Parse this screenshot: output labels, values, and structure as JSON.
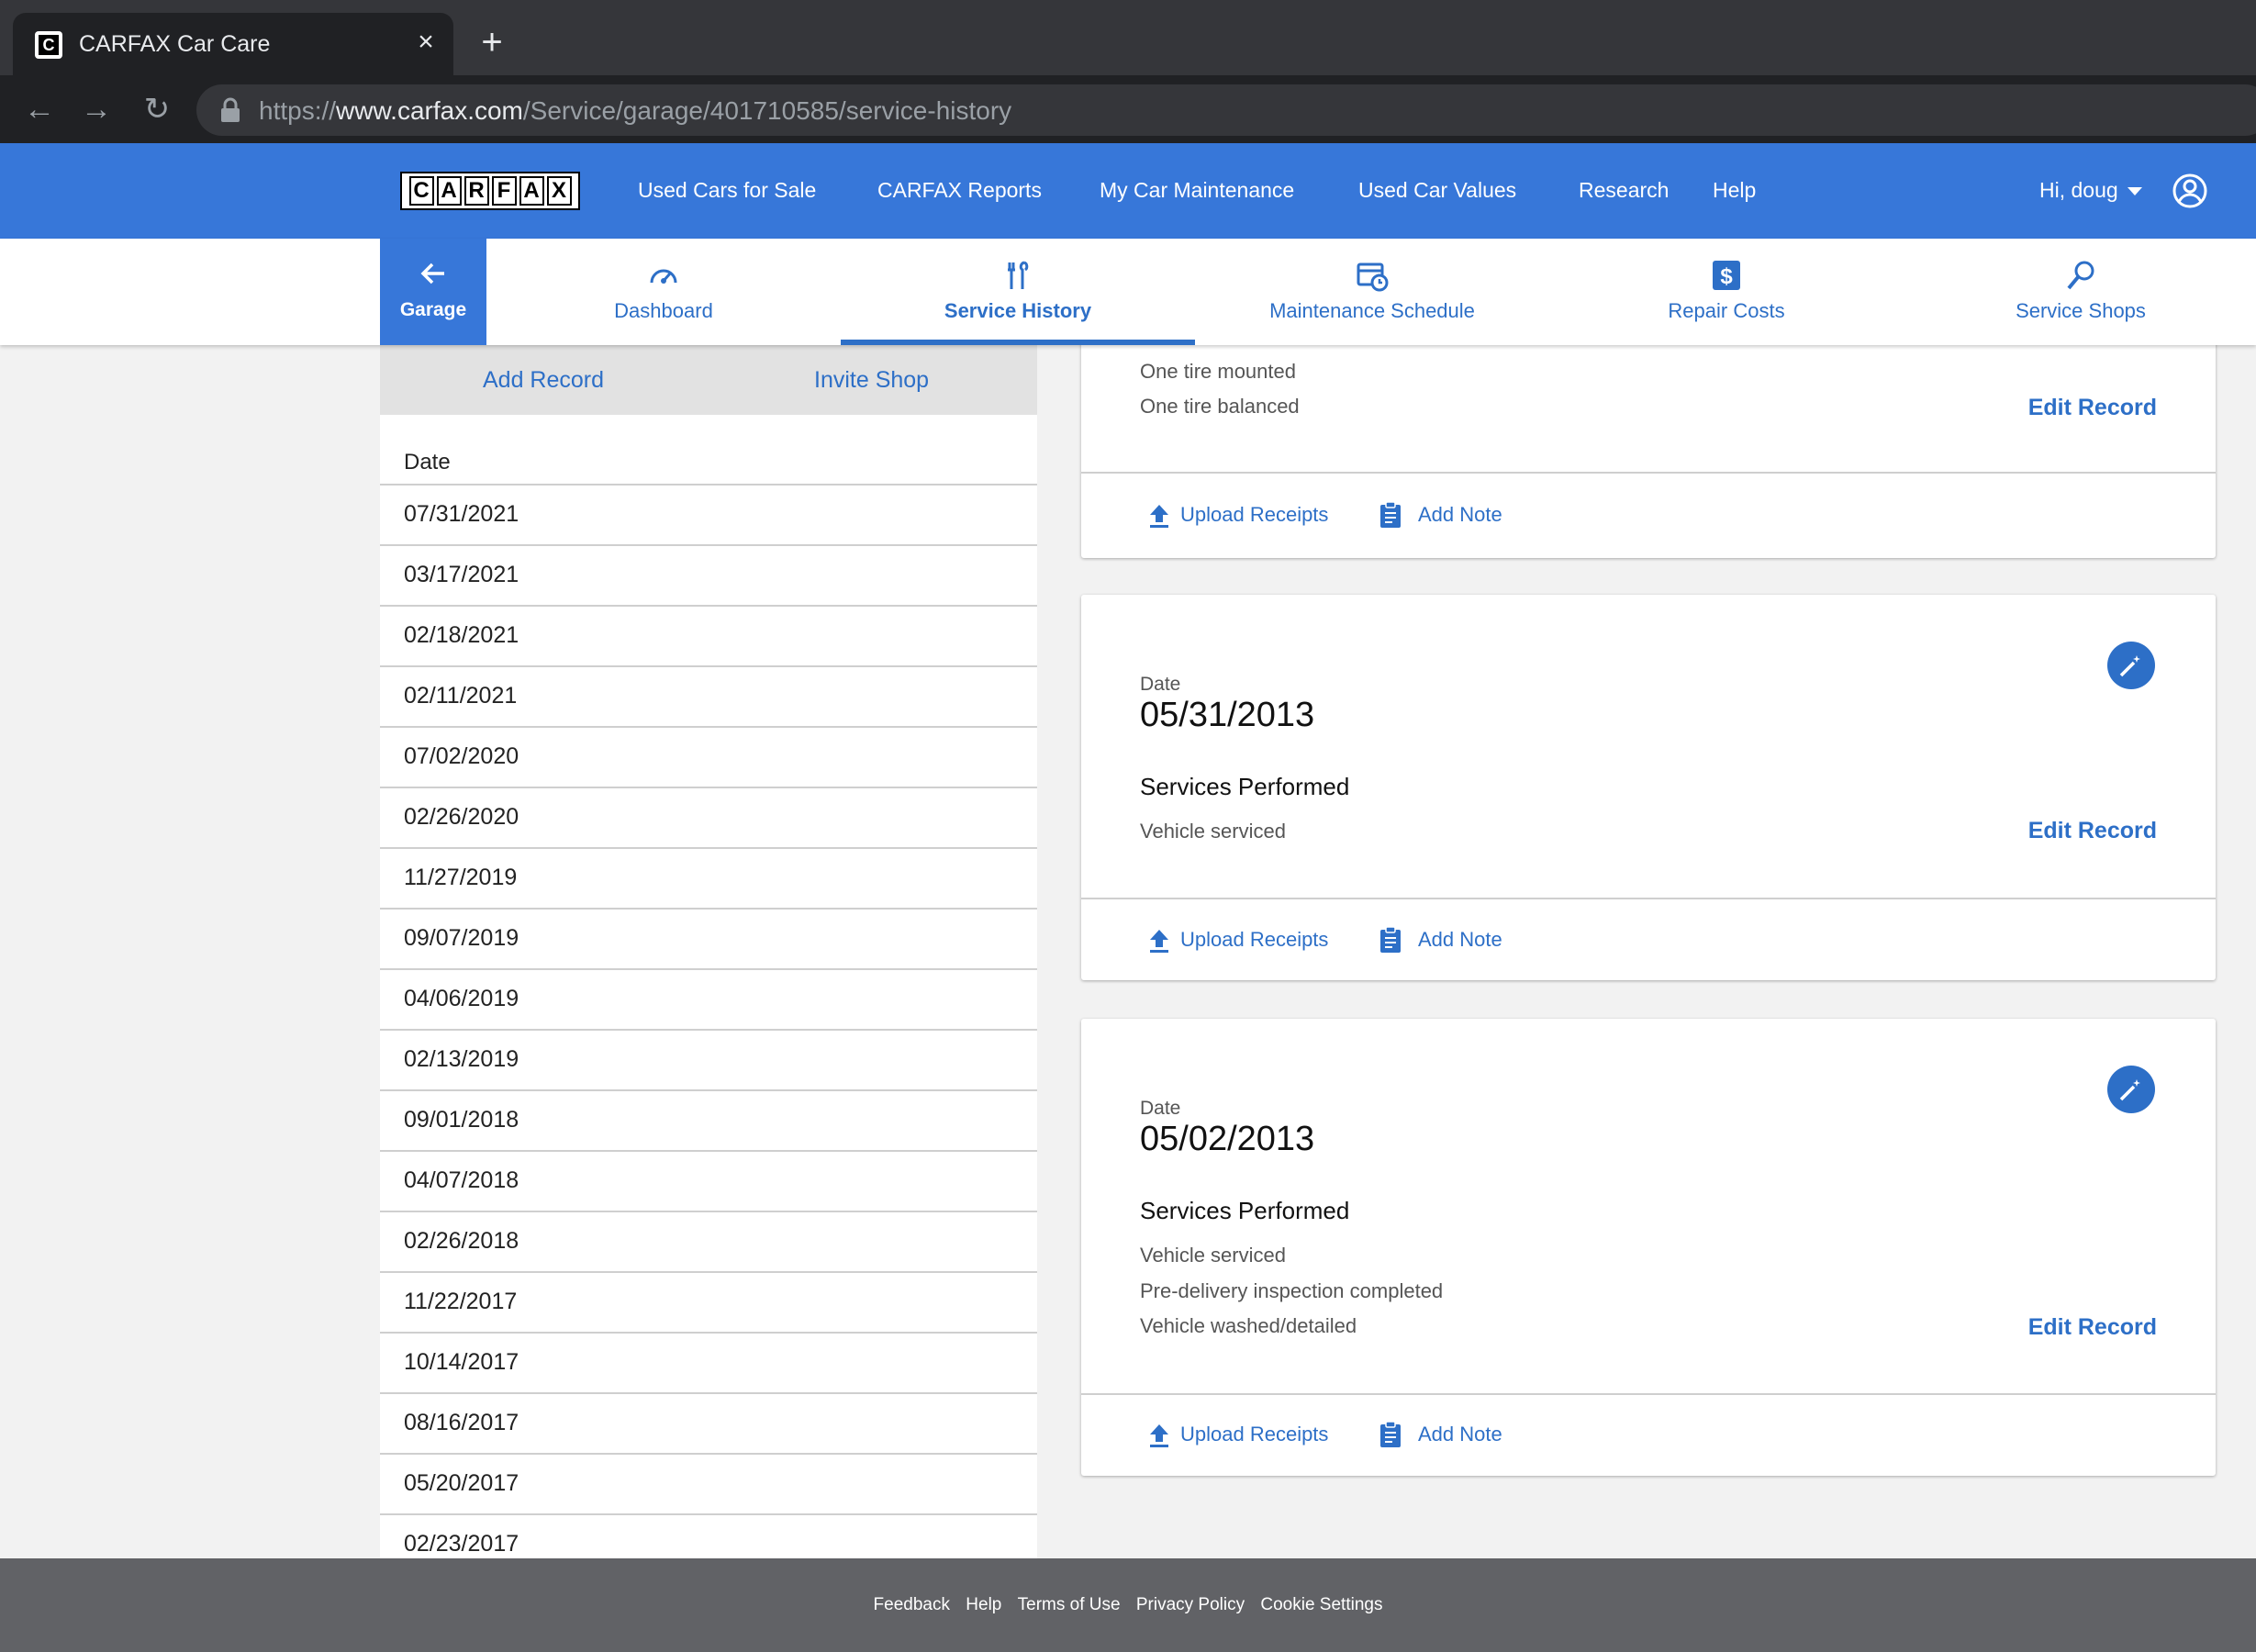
{
  "browser": {
    "tab_title": "CARFAX Car Care",
    "close_glyph": "×",
    "new_tab_glyph": "+",
    "back_glyph": "←",
    "forward_glyph": "→",
    "reload_glyph": "↻",
    "url_prefix": "https://",
    "url_domain": "www.carfax.com",
    "url_path": "/Service/garage/401710585/service-history"
  },
  "header": {
    "logo_letters": [
      "C",
      "A",
      "R",
      "F",
      "A",
      "X"
    ],
    "nav": [
      "Used Cars for Sale",
      "CARFAX Reports",
      "My Car Maintenance",
      "Used Car Values",
      "Research",
      "Help"
    ],
    "user_greeting": "Hi, doug",
    "brand_color": "#3777d9"
  },
  "subnav": {
    "garage_label": "Garage",
    "tabs": [
      {
        "label": "Dashboard",
        "icon": "speedometer-icon"
      },
      {
        "label": "Service History",
        "icon": "wrench-icon",
        "active": true
      },
      {
        "label": "Maintenance Schedule",
        "icon": "calendar-clock-icon"
      },
      {
        "label": "Repair Costs",
        "icon": "dollar-icon"
      },
      {
        "label": "Service Shops",
        "icon": "search-icon"
      }
    ]
  },
  "left_panel": {
    "add_record": "Add Record",
    "invite_shop": "Invite Shop",
    "date_header": "Date",
    "dates": [
      "07/31/2021",
      "03/17/2021",
      "02/18/2021",
      "02/11/2021",
      "07/02/2020",
      "02/26/2020",
      "11/27/2019",
      "09/07/2019",
      "04/06/2019",
      "02/13/2019",
      "09/01/2018",
      "04/07/2018",
      "02/26/2018",
      "11/22/2017",
      "10/14/2017",
      "08/16/2017",
      "05/20/2017",
      "02/23/2017"
    ]
  },
  "records": [
    {
      "services": [
        "One tire mounted",
        "One tire balanced"
      ],
      "edit_label": "Edit Record",
      "upload_label": "Upload Receipts",
      "note_label": "Add Note"
    },
    {
      "date_label": "Date",
      "date": "05/31/2013",
      "services_title": "Services Performed",
      "services": [
        "Vehicle serviced"
      ],
      "edit_label": "Edit Record",
      "upload_label": "Upload Receipts",
      "note_label": "Add Note"
    },
    {
      "date_label": "Date",
      "date": "05/02/2013",
      "services_title": "Services Performed",
      "services": [
        "Vehicle serviced",
        "Pre-delivery inspection completed",
        "Vehicle washed/detailed"
      ],
      "edit_label": "Edit Record",
      "upload_label": "Upload Receipts",
      "note_label": "Add Note"
    }
  ],
  "footer": {
    "links": [
      "Feedback",
      "Help",
      "Terms of Use",
      "Privacy Policy",
      "Cookie Settings"
    ]
  }
}
